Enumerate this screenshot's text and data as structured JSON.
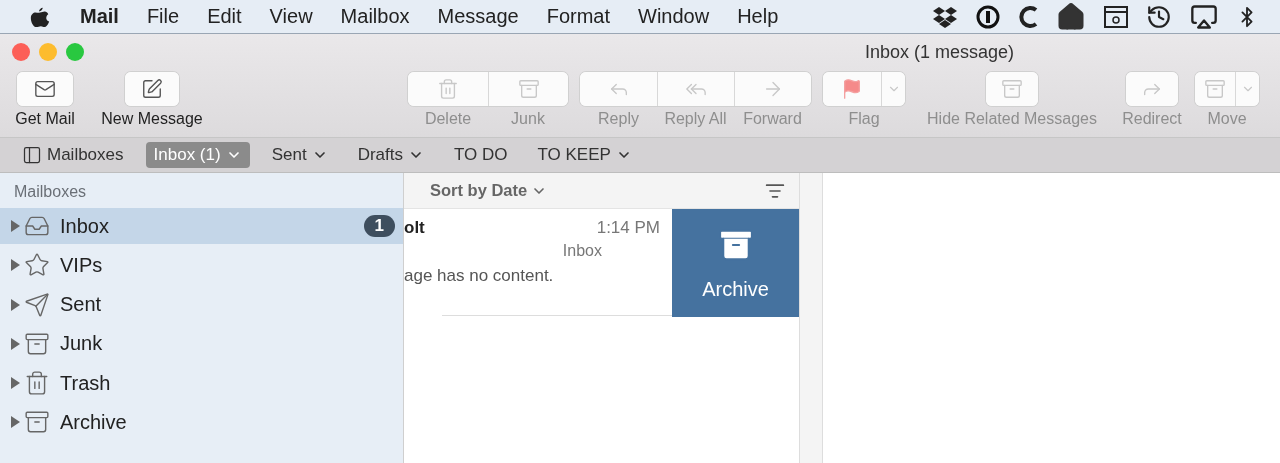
{
  "menu_bar": {
    "app": "Mail",
    "items": [
      "File",
      "Edit",
      "View",
      "Mailbox",
      "Message",
      "Format",
      "Window",
      "Help"
    ]
  },
  "window": {
    "title": "Inbox (1 message)"
  },
  "toolbar": [
    {
      "items": [
        {
          "label": "Get Mail",
          "disabled": false
        }
      ]
    },
    {
      "items": [
        {
          "label": "New Message",
          "disabled": false
        }
      ]
    },
    {
      "items": [
        {
          "label": "Delete",
          "disabled": true
        },
        {
          "label": "Junk",
          "disabled": true
        }
      ]
    },
    {
      "items": [
        {
          "label": "Reply",
          "disabled": true
        },
        {
          "label": "Reply All",
          "disabled": true
        },
        {
          "label": "Forward",
          "disabled": true
        }
      ]
    },
    {
      "items": [
        {
          "label": "Flag",
          "disabled": true
        }
      ]
    },
    {
      "items": [
        {
          "label": "Hide Related Messages",
          "disabled": true
        }
      ]
    },
    {
      "items": [
        {
          "label": "Redirect",
          "disabled": true
        }
      ]
    },
    {
      "items": [
        {
          "label": "Move",
          "disabled": true
        }
      ]
    }
  ],
  "favorites_bar": [
    {
      "label": "Mailboxes",
      "selected": false,
      "dropdown": false
    },
    {
      "label": "Inbox (1)",
      "selected": true,
      "dropdown": true
    },
    {
      "label": "Sent",
      "selected": false,
      "dropdown": true
    },
    {
      "label": "Drafts",
      "selected": false,
      "dropdown": true
    },
    {
      "label": "TO DO",
      "selected": false,
      "dropdown": false
    },
    {
      "label": "TO KEEP",
      "selected": false,
      "dropdown": true
    }
  ],
  "sidebar": {
    "heading": "Mailboxes",
    "items": [
      {
        "label": "Inbox",
        "selected": true,
        "expanded": false,
        "badge": "1"
      },
      {
        "label": "VIPs",
        "selected": false,
        "expanded": false
      },
      {
        "label": "Sent",
        "selected": false,
        "expanded": false
      },
      {
        "label": "Junk",
        "selected": false,
        "expanded": false
      },
      {
        "label": "Trash",
        "selected": false,
        "expanded": false
      },
      {
        "label": "Archive",
        "selected": false,
        "expanded": false
      }
    ]
  },
  "message_list": {
    "sort": "Sort by Date",
    "messages": [
      {
        "sender": "olt",
        "time": "1:14 PM",
        "mailbox": "Inbox",
        "preview": "age has no content.",
        "swipe_action": "Archive"
      }
    ]
  }
}
